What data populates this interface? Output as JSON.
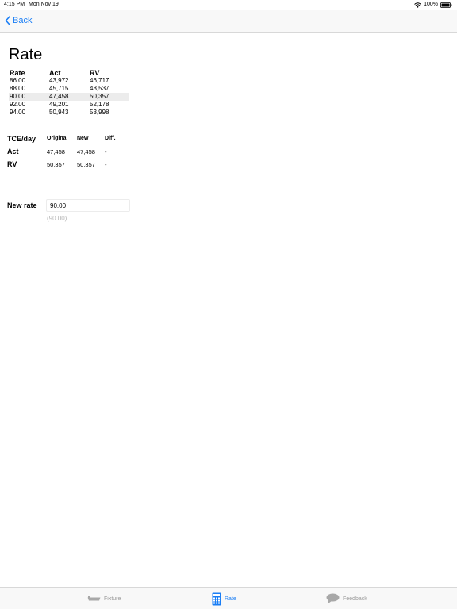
{
  "status_bar": {
    "time": "4:15 PM",
    "date": "Mon Nov 19",
    "battery": "100%"
  },
  "nav": {
    "back_label": "Back"
  },
  "page": {
    "title": "Rate"
  },
  "rate_table": {
    "headers": [
      "Rate",
      "Act",
      "RV"
    ],
    "rows": [
      [
        "86.00",
        "43,972",
        "46,717"
      ],
      [
        "88.00",
        "45,715",
        "48,537"
      ],
      [
        "90.00",
        "47,458",
        "50,357"
      ],
      [
        "92.00",
        "49,201",
        "52,178"
      ],
      [
        "94.00",
        "50,943",
        "53,998"
      ]
    ],
    "selected_row": 2
  },
  "tce": {
    "label": "TCE/day",
    "columns": [
      "Original",
      "New",
      "Diff."
    ],
    "rows": [
      {
        "label": "Act",
        "original": "47,458",
        "new": "47,458",
        "diff": "-"
      },
      {
        "label": "RV",
        "original": "50,357",
        "new": "50,357",
        "diff": "-"
      }
    ]
  },
  "new_rate": {
    "label": "New rate",
    "value": "90.00",
    "hint": "(90.00)"
  },
  "tabs": [
    {
      "label": "Fixture",
      "icon": "ship-icon",
      "active": false
    },
    {
      "label": "Rate",
      "icon": "calculator-icon",
      "active": true
    },
    {
      "label": "Feedback",
      "icon": "speech-bubble-icon",
      "active": false
    }
  ],
  "colors": {
    "accent": "#1a7ef5",
    "inactive_tab": "#9a9a9a",
    "selected_row": "#ececec",
    "bar_background": "#f8f8f8"
  }
}
